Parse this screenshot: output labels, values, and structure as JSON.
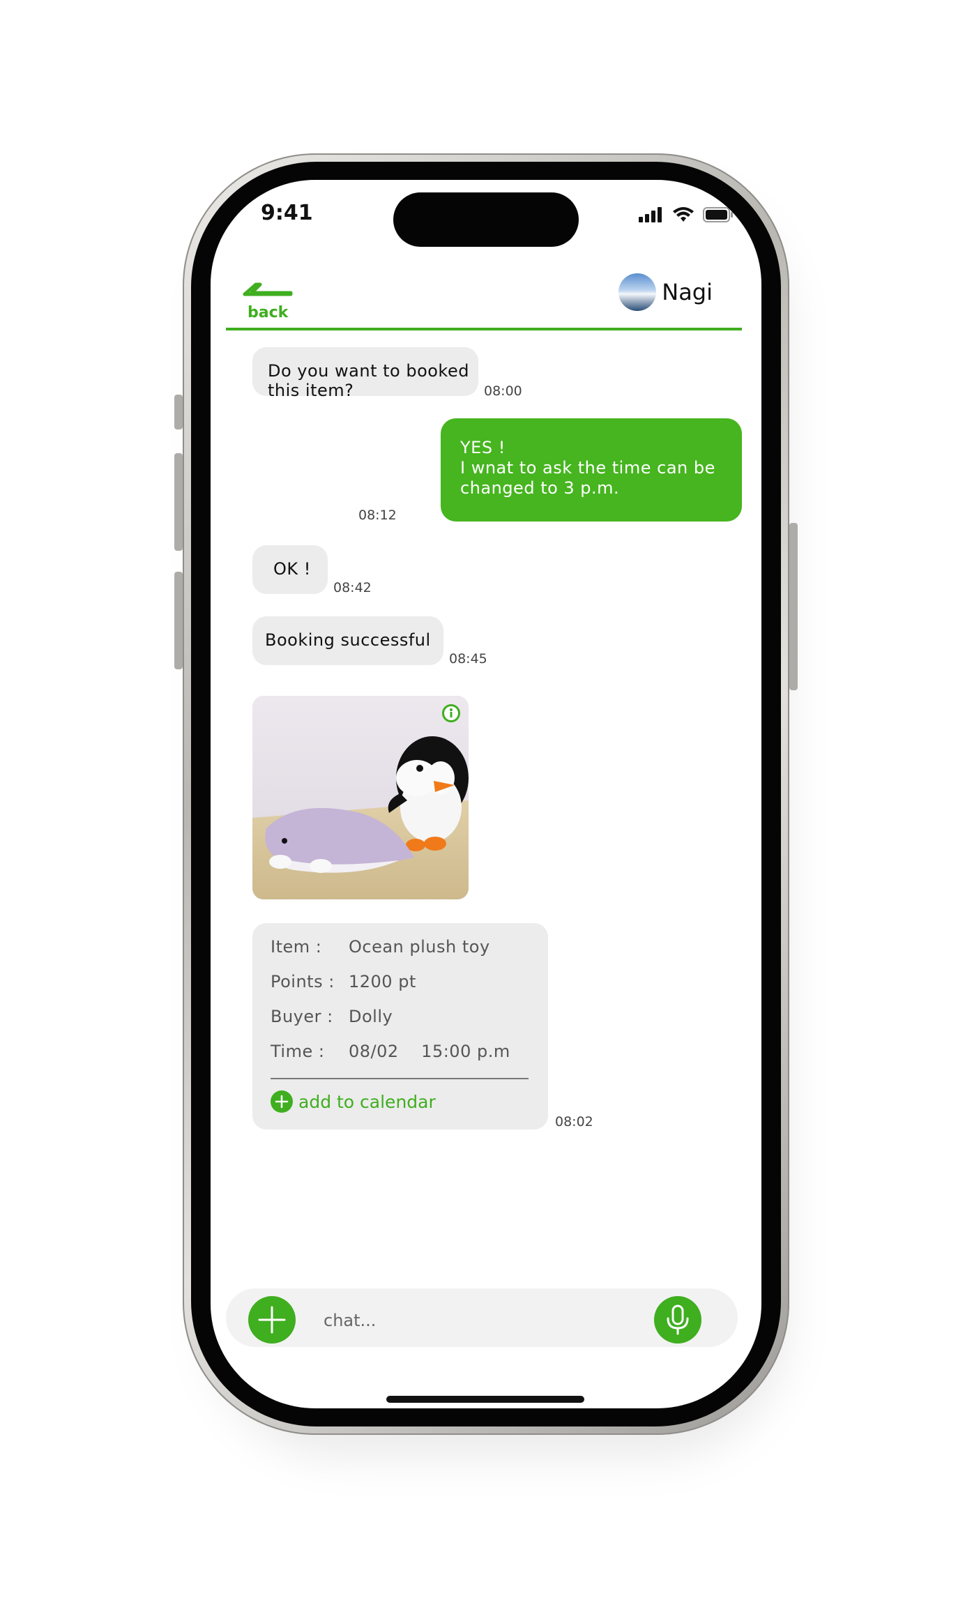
{
  "status_bar": {
    "time": "9:41"
  },
  "header": {
    "back_label": "back",
    "contact_name": "Nagi"
  },
  "messages": [
    {
      "text": "Do you want to booked this item?",
      "time": "08:00"
    },
    {
      "line1": "YES !",
      "line2": "I wnat to ask the time can be",
      "line3": "changed to 3 p.m.",
      "time": "08:12"
    },
    {
      "text": "OK !",
      "time": "08:42"
    },
    {
      "text": "Booking successful",
      "time": "08:45"
    }
  ],
  "booking": {
    "item_label": "Item :",
    "item_value": "Ocean plush toy",
    "points_label": "Points :",
    "points_value": "1200 pt",
    "buyer_label": "Buyer :",
    "buyer_value": "Dolly",
    "time_label": "Time :",
    "time_value": "08/02    15:00 p.m",
    "calendar_label": "add to calendar",
    "time": "08:02"
  },
  "input": {
    "placeholder": "chat..."
  },
  "colors": {
    "accent": "#3fae1f",
    "bubble_out": "#46b51f",
    "bubble_in": "#ececec"
  },
  "icons": [
    "back-arrow-icon",
    "signal-icon",
    "wifi-icon",
    "battery-icon",
    "info-icon",
    "plus-icon",
    "mic-icon"
  ]
}
